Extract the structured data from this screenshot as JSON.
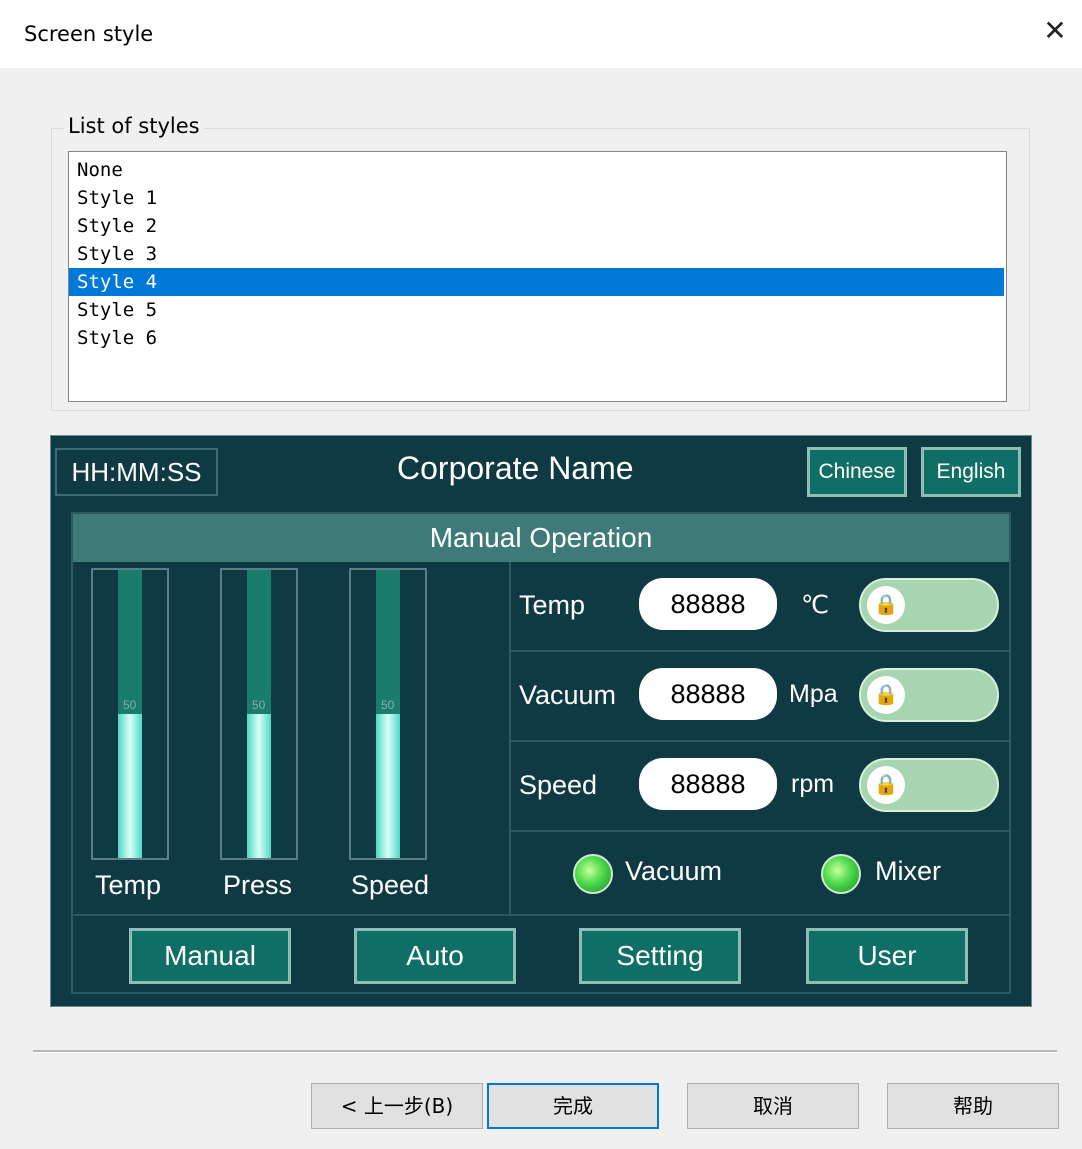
{
  "window": {
    "title": "Screen style",
    "close_glyph": "✕"
  },
  "styles_group": {
    "label": "List of styles",
    "items": [
      "None",
      "Style 1",
      "Style 2",
      "Style 3",
      "Style 4",
      "Style 5",
      "Style 6"
    ],
    "selected": "Style 4"
  },
  "preview": {
    "clock": "HH:MM:SS",
    "corporate_name": "Corporate Name",
    "lang_buttons": [
      "Chinese",
      "English"
    ],
    "header": "Manual Operation",
    "gauges": [
      {
        "label": "Temp",
        "mark": "50",
        "level": 0.5
      },
      {
        "label": "Press",
        "mark": "50",
        "level": 0.5
      },
      {
        "label": "Speed",
        "mark": "50",
        "level": 0.5
      }
    ],
    "readings": [
      {
        "label": "Temp",
        "value": "88888",
        "unit": "℃"
      },
      {
        "label": "Vacuum",
        "value": "88888",
        "unit": "Mpa"
      },
      {
        "label": "Speed",
        "value": "88888",
        "unit": "rpm"
      }
    ],
    "lock_icon": "🔒",
    "indicators": [
      {
        "label": "Vacuum",
        "color": "#4bd94b"
      },
      {
        "label": "Mixer",
        "color": "#4bd94b"
      }
    ],
    "nav_buttons": [
      "Manual",
      "Auto",
      "Setting",
      "User"
    ]
  },
  "footer": {
    "back_label": "< 上一步(B)",
    "finish_label": "完成",
    "cancel_label": "取消",
    "help_label": "帮助"
  },
  "colors": {
    "selection": "#0078d7",
    "preview_bg": "#0f3a44",
    "panel_header": "#3e7b78"
  }
}
